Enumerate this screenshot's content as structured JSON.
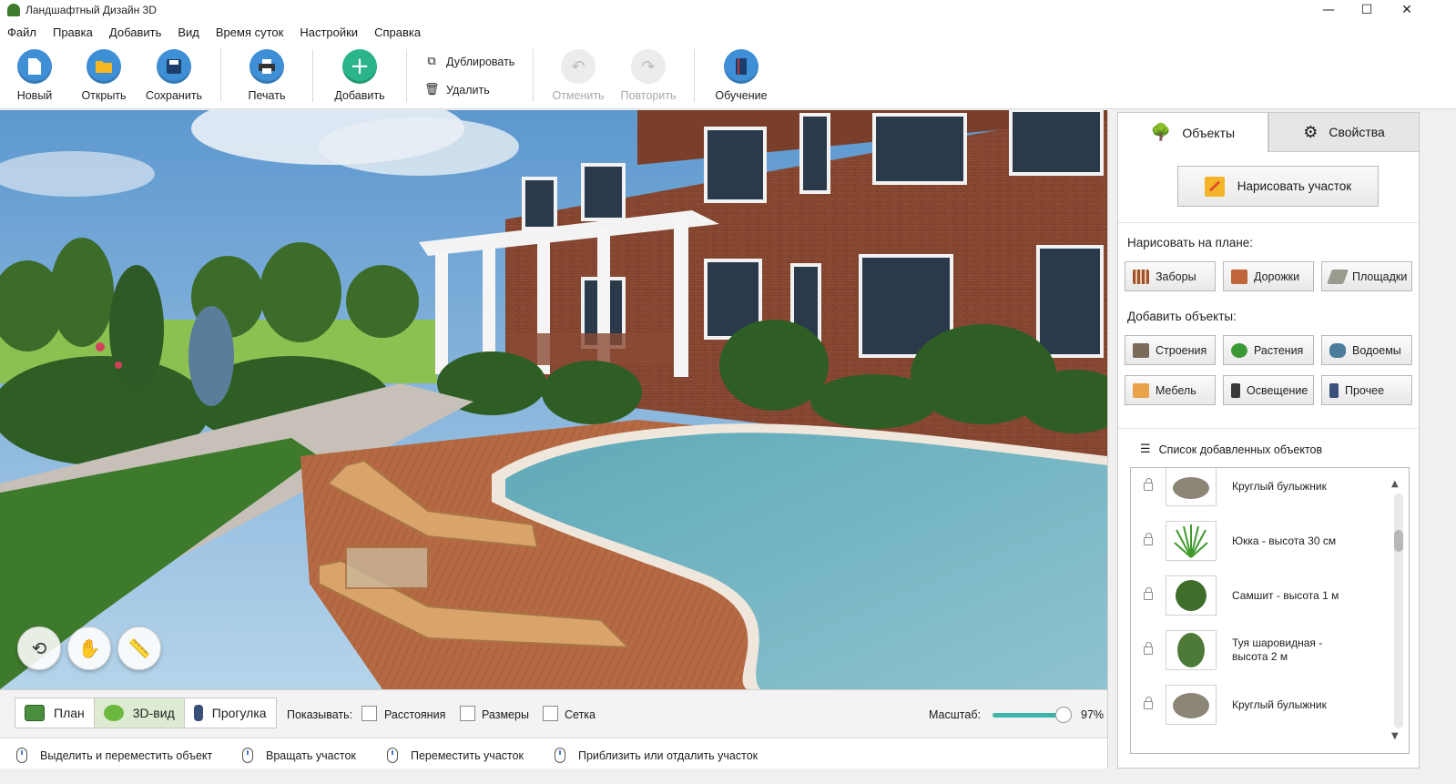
{
  "window": {
    "title": "Ландшафтный Дизайн 3D",
    "minimize": "—",
    "maximize": "☐",
    "close": "✕"
  },
  "menu": [
    "Файл",
    "Правка",
    "Добавить",
    "Вид",
    "Время суток",
    "Настройки",
    "Справка"
  ],
  "toolbar": {
    "new": "Новый",
    "open": "Открыть",
    "save": "Сохранить",
    "print": "Печать",
    "add": "Добавить",
    "duplicate": "Дублировать",
    "delete": "Удалить",
    "undo": "Отменить",
    "redo": "Повторить",
    "tutorial": "Обучение"
  },
  "view_modes": {
    "plan": "План",
    "view3d": "3D-вид",
    "walk": "Прогулка",
    "active": "3D-вид"
  },
  "display": {
    "show_label": "Показывать:",
    "options": [
      {
        "label": "Расстояния",
        "checked": false
      },
      {
        "label": "Размеры",
        "checked": false
      },
      {
        "label": "Сетка",
        "checked": false
      }
    ],
    "zoom_label": "Масштаб:",
    "zoom_value": "97%",
    "zoom_level": 0.97
  },
  "status_hints": [
    "Выделить и переместить объект",
    "Вращать участок",
    "Переместить участок",
    "Приблизить или отдалить участок"
  ],
  "panel": {
    "tabs": {
      "objects": "Объекты",
      "properties": "Свойства",
      "active": "Объекты"
    },
    "draw_plot": "Нарисовать участок",
    "draw_on_plan_label": "Нарисовать на плане:",
    "draw_items": [
      "Заборы",
      "Дорожки",
      "Площадки"
    ],
    "add_objects_label": "Добавить объекты:",
    "add_items": [
      "Строения",
      "Растения",
      "Водоемы",
      "Мебель",
      "Освещение",
      "Прочее"
    ],
    "list_title": "Список добавленных объектов",
    "list_items": [
      {
        "name": "Круглый булыжник",
        "icon": "boulder-icon"
      },
      {
        "name": "Юкка - высота 30 см",
        "icon": "yucca-icon"
      },
      {
        "name": "Самшит - высота 1 м",
        "icon": "boxwood-icon"
      },
      {
        "name": "Туя шаровидная - высота 2 м",
        "icon": "thuja-icon"
      },
      {
        "name": "Круглый булыжник",
        "icon": "boulder-icon"
      }
    ]
  },
  "colors": {
    "accent_teal": "#3fb4a8",
    "blue_button": "#3f8fd6",
    "green_button": "#2bb48a",
    "active_tab": "#dcebd2"
  }
}
